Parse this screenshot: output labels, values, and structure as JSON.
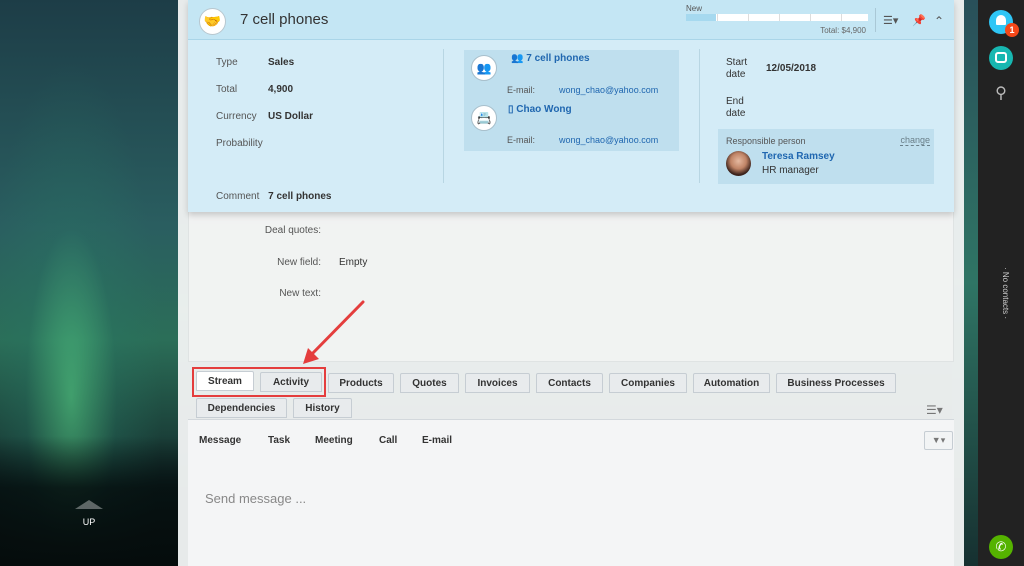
{
  "side": {
    "up_label": "UP",
    "no_contacts": "· No contacts ·"
  },
  "right_bar": {
    "badge_count": "1"
  },
  "deal": {
    "title": "7 cell phones",
    "stage_label": "New",
    "stage_total": "Total: $4,900",
    "fields": {
      "type_label": "Type",
      "type_value": "Sales",
      "total_label": "Total",
      "total_value": "4,900",
      "currency_label": "Currency",
      "currency_value": "US Dollar",
      "probability_label": "Probability",
      "probability_value": "",
      "comment_label": "Comment",
      "comment_value": "7 cell phones"
    },
    "contacts": {
      "company_name": "7 cell phones",
      "company_email_label": "E-mail:",
      "company_email": "wong_chao@yahoo.com",
      "contact_name": "Chao Wong",
      "contact_email_label": "E-mail:",
      "contact_email": "wong_chao@yahoo.com"
    },
    "dates": {
      "start_label": "Start date",
      "start_value": "12/05/2018",
      "end_label": "End date",
      "end_value": ""
    },
    "responsible": {
      "title": "Responsible person",
      "change": "change",
      "name": "Teresa Ramsey",
      "role": "HR manager"
    }
  },
  "extra_fields": [
    {
      "label": "Deal quotes:",
      "value": ""
    },
    {
      "label": "New field:",
      "value": "Empty"
    },
    {
      "label": "New text:",
      "value": ""
    }
  ],
  "tabs": {
    "stream": "Stream",
    "activity": "Activity",
    "products": "Products",
    "quotes": "Quotes",
    "invoices": "Invoices",
    "contacts": "Contacts",
    "companies": "Companies",
    "automation": "Automation",
    "business_processes": "Business Processes",
    "dependencies": "Dependencies",
    "history": "History"
  },
  "stream": {
    "message": "Message",
    "task": "Task",
    "meeting": "Meeting",
    "call": "Call",
    "email": "E-mail",
    "placeholder": "Send message ..."
  },
  "colors": {
    "highlight": "#e43d3d",
    "link": "#2067b0",
    "stage_fill": "#a6d9ef"
  }
}
